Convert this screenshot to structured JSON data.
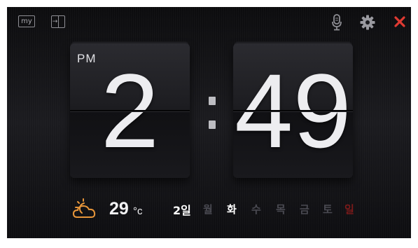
{
  "topbar": {
    "my_label": "my",
    "split_arrow": "→",
    "mic": "microphone-icon",
    "settings": "gear-icon",
    "close": "close-icon"
  },
  "clock": {
    "ampm": "PM",
    "hours": "2",
    "separator": ":",
    "minutes": "49"
  },
  "weather": {
    "icon": "cloudy-sun-icon",
    "temperature": "29",
    "unit": "°c"
  },
  "date": {
    "day": "2일",
    "weekdays": [
      {
        "label": "월",
        "active": false
      },
      {
        "label": "화",
        "active": true
      },
      {
        "label": "수",
        "active": false
      },
      {
        "label": "목",
        "active": false
      },
      {
        "label": "금",
        "active": false
      },
      {
        "label": "토",
        "active": false
      },
      {
        "label": "일",
        "active": false
      }
    ]
  },
  "colors": {
    "active_weekday": "#ffffff",
    "inactive_weekday": "#4a4a52",
    "sunday": "#7a1a1a",
    "close_red": "#e03a32",
    "weather_orange": "#e8963a"
  }
}
